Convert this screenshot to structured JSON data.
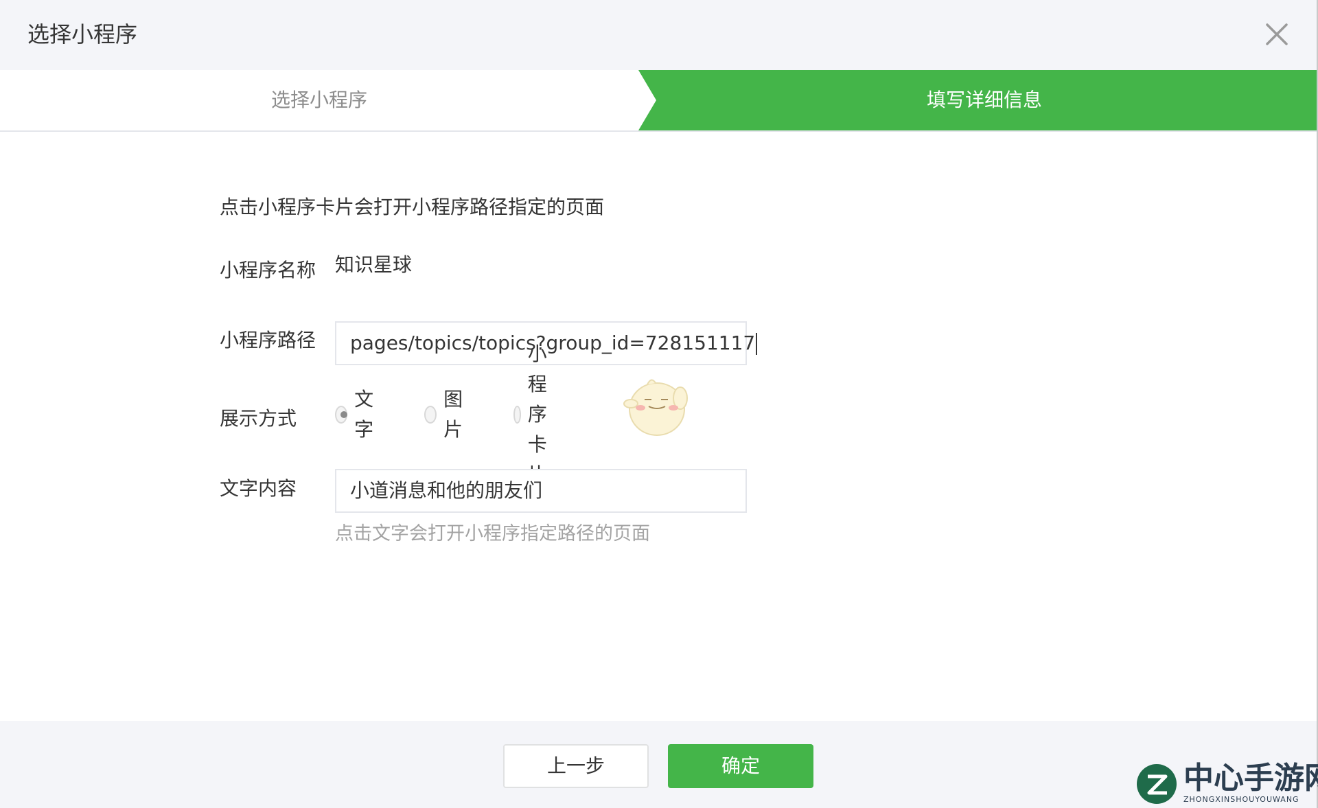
{
  "dialog": {
    "title": "选择小程序"
  },
  "steps": [
    {
      "label": "选择小程序",
      "active": false
    },
    {
      "label": "填写详细信息",
      "active": true
    }
  ],
  "form": {
    "intro": "点击小程序卡片会打开小程序路径指定的页面",
    "name_label": "小程序名称",
    "name_value": "知识星球",
    "path_label": "小程序路径",
    "path_value": "pages/topics/topics?group_id=728151117",
    "display_label": "展示方式",
    "display_options": [
      {
        "label": "文字",
        "checked": true
      },
      {
        "label": "图片",
        "checked": false
      },
      {
        "label": "小程序卡片",
        "checked": false
      }
    ],
    "text_label": "文字内容",
    "text_value": "小道消息和他的朋友们",
    "text_hint": "点击文字会打开小程序指定路径的页面"
  },
  "footer": {
    "prev_label": "上一步",
    "confirm_label": "确定"
  },
  "watermark": {
    "text": "中心手游网",
    "sub": "ZHONGXINSHOUYOUWANG"
  },
  "colors": {
    "accent": "#44b549",
    "header_bg": "#f4f5f9",
    "hint": "#a3a3a3"
  }
}
